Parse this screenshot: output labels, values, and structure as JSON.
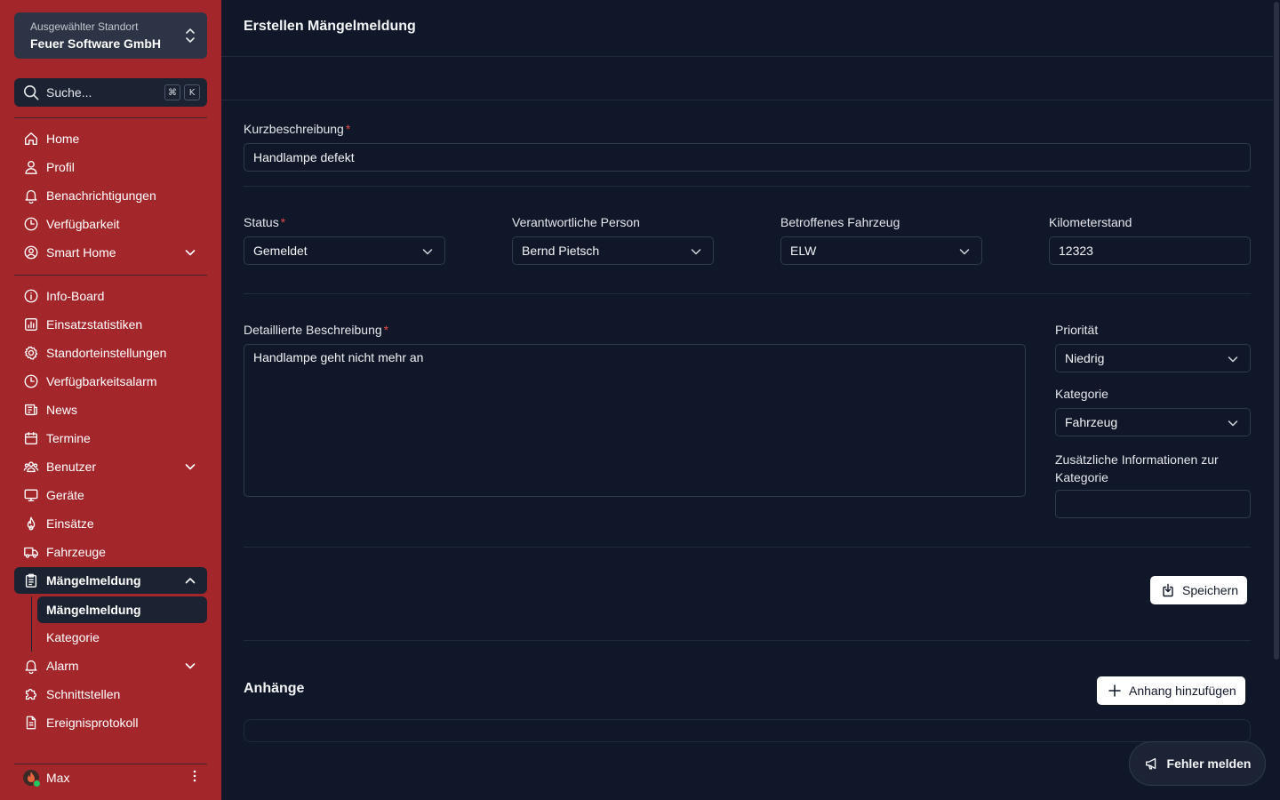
{
  "sidebar": {
    "site_switch": {
      "label": "Ausgewählter Standort",
      "name": "Feuer Software GmbH"
    },
    "search": {
      "placeholder": "Suche...",
      "kbd1": "⌘",
      "kbd2": "K"
    },
    "group1": [
      {
        "label": "Home",
        "icon": "home-icon"
      },
      {
        "label": "Profil",
        "icon": "user-icon"
      },
      {
        "label": "Benachrichtigungen",
        "icon": "bell-icon"
      },
      {
        "label": "Verfügbarkeit",
        "icon": "clock-icon"
      },
      {
        "label": "Smart Home",
        "icon": "user-circle-icon"
      }
    ],
    "group2": [
      {
        "label": "Info-Board",
        "icon": "info-icon"
      },
      {
        "label": "Einsatzstatistiken",
        "icon": "chart-icon"
      },
      {
        "label": "Standorteinstellungen",
        "icon": "gear-icon"
      },
      {
        "label": "Verfügbarkeitsalarm",
        "icon": "clock-icon"
      },
      {
        "label": "News",
        "icon": "newspaper-icon"
      },
      {
        "label": "Termine",
        "icon": "calendar-icon"
      },
      {
        "label": "Benutzer",
        "icon": "users-icon"
      },
      {
        "label": "Geräte",
        "icon": "monitor-icon"
      },
      {
        "label": "Einsätze",
        "icon": "fire-icon"
      },
      {
        "label": "Fahrzeuge",
        "icon": "truck-icon"
      },
      {
        "label": "Mängelmeldung",
        "icon": "clipboard-icon"
      }
    ],
    "sub_items": [
      {
        "label": "Mängelmeldung"
      },
      {
        "label": "Kategorie"
      }
    ],
    "group3": [
      {
        "label": "Alarm",
        "icon": "bell-icon"
      },
      {
        "label": "Schnittstellen",
        "icon": "puzzle-icon"
      },
      {
        "label": "Ereignisprotokoll",
        "icon": "document-icon"
      }
    ],
    "user": {
      "name": "Max"
    }
  },
  "main": {
    "title": "Erstellen Mängelmeldung",
    "kurzbeschreibung": {
      "label": "Kurzbeschreibung",
      "value": "Handlampe defekt"
    },
    "status": {
      "label": "Status",
      "value": "Gemeldet"
    },
    "person": {
      "label": "Verantwortliche Person",
      "value": "Bernd Pietsch"
    },
    "fahrzeug": {
      "label": "Betroffenes Fahrzeug",
      "value": "ELW"
    },
    "km": {
      "label": "Kilometerstand",
      "value": "12323"
    },
    "beschreibung": {
      "label": "Detaillierte Beschreibung",
      "value": "Handlampe geht nicht mehr an"
    },
    "prioritaet": {
      "label": "Priorität",
      "value": "Niedrig"
    },
    "kategorie": {
      "label": "Kategorie",
      "value": "Fahrzeug"
    },
    "zusatz": {
      "label": "Zusätzliche Informationen zur Kategorie",
      "value": ""
    },
    "save_label": "Speichern",
    "attachments_title": "Anhänge",
    "add_attachment_label": "Anhang hinzufügen",
    "report_label": "Fehler melden",
    "required_mark": "*"
  }
}
